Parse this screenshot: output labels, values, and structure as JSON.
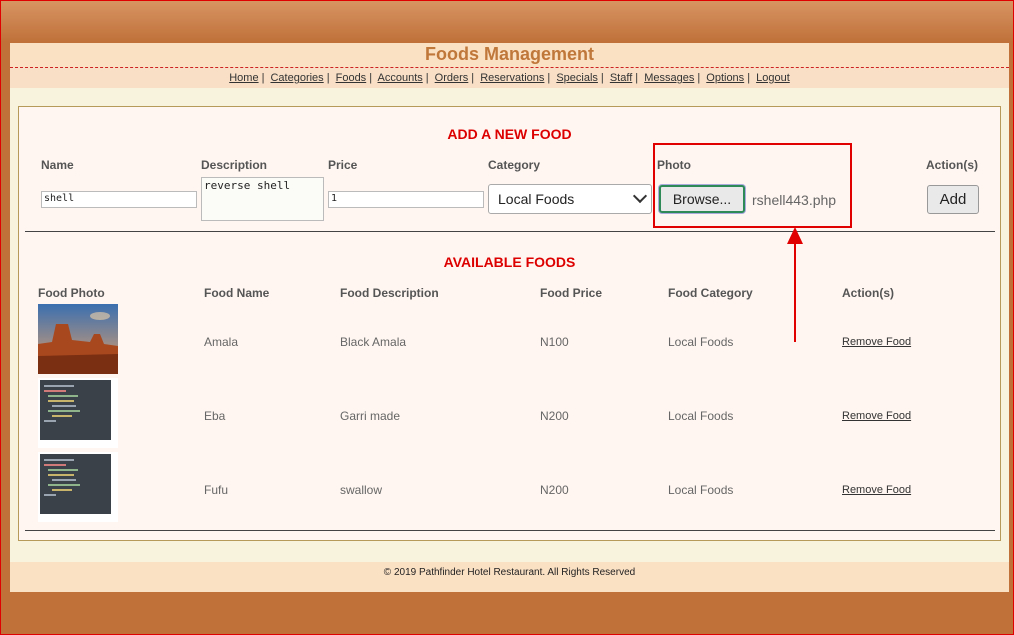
{
  "site": {
    "title": "Foods Management"
  },
  "nav": [
    "Home",
    "Categories",
    "Foods",
    "Accounts",
    "Orders",
    "Reservations",
    "Specials",
    "Staff",
    "Messages",
    "Options",
    "Logout"
  ],
  "add_food": {
    "heading": "ADD A NEW FOOD",
    "name_label": "Name",
    "description_label": "Description",
    "price_label": "Price",
    "category_label": "Category",
    "photo_label": "Photo",
    "actions_label": "Action(s)",
    "name_value": "shell",
    "description_value": "reverse shell",
    "price_value": "1",
    "category_value": "Local Foods",
    "browse_label": "Browse...",
    "file_name": "rshell443.php",
    "add_label": "Add"
  },
  "available": {
    "heading": "AVAILABLE FOODS",
    "columns": [
      "Food Photo",
      "Food Name",
      "Food Description",
      "Food Price",
      "Food Category",
      "Action(s)"
    ],
    "rows": [
      {
        "name": "Amala",
        "description": "Black Amala",
        "price": "N100",
        "category": "Local Foods",
        "action": "Remove Food"
      },
      {
        "name": "Eba",
        "description": "Garri made",
        "price": "N200",
        "category": "Local Foods",
        "action": "Remove Food"
      },
      {
        "name": "Fufu",
        "description": "swallow",
        "price": "N200",
        "category": "Local Foods",
        "action": "Remove Food"
      }
    ]
  },
  "footer": {
    "text": "© 2019 Pathfinder Hotel Restaurant. All Rights Reserved"
  },
  "colors": {
    "accent": "#c0773a",
    "heading_red": "#dd0000",
    "annotation_red": "#e00000"
  }
}
